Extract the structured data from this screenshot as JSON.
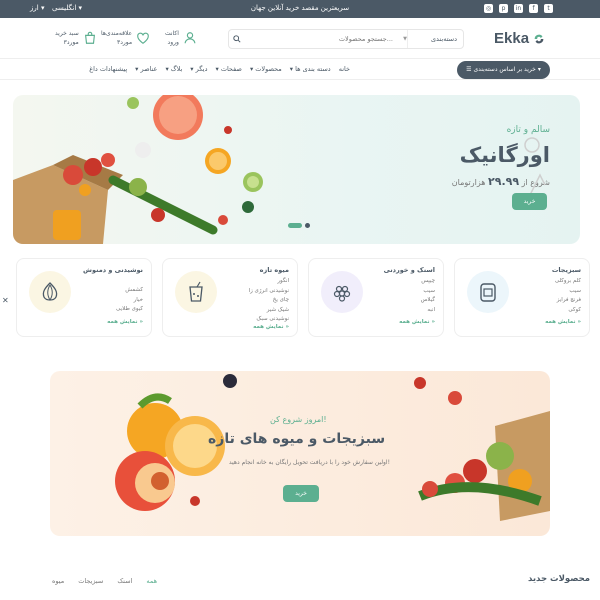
{
  "topbar": {
    "tagline": "سریعترین مقصد خرید آنلاین جهان",
    "language": "انگلیسی ▾",
    "currency": "ارز ▾",
    "socials": [
      "instagram-icon",
      "pinterest-icon",
      "linkedin-icon",
      "facebook-icon",
      "twitter-icon"
    ]
  },
  "header": {
    "logo": "Ekka",
    "search_placeholder": "جستجو محصولات...",
    "search_category": "دسته‌بندی",
    "account_line1": "اکانت",
    "account_line2": "ورود",
    "wishlist_line1": "علاقه‌مندی‌ها",
    "wishlist_line2": "۳مورد",
    "cart_line1": "سبد خرید",
    "cart_line2": "۳مورد"
  },
  "nav": {
    "category_button": "☰ خرید بر اساس دسته‌بندی ▾",
    "links": [
      "خانه",
      "دسته بندی ها ▾",
      "محصولات ▾",
      "صفحات ▾",
      "دیگر ▾",
      "بلاگ ▾",
      "عناصر ▾",
      "پیشنهادات داغ"
    ]
  },
  "hero": {
    "subtitle": "سالم و تازه",
    "title": "اورگانیک",
    "price_prefix": "شروع از",
    "price_value": "۲۹.۹۹",
    "price_suffix": "هزارتومان",
    "button": "خرید",
    "active_slide": 1,
    "slide_count": 2
  },
  "categories": [
    {
      "title": "سبزیجات",
      "items": [
        "کلم بروکلی",
        "سیب",
        "فرنچ فرایز",
        "کوکی"
      ],
      "more": "نمایش همه »",
      "icon": "jar-icon",
      "tint": "#ecf6fb"
    },
    {
      "title": "اسنک و خوردنی",
      "items": [
        "چیپس",
        "سیب",
        "گیلاس",
        "انبه"
      ],
      "more": "نمایش همه »",
      "icon": "grapes-icon",
      "tint": "#f1eefb"
    },
    {
      "title": "میوه تازه",
      "items": [
        "انگور",
        "نوشیدنی انرژی زا",
        "چای یخ",
        "شیک شیر",
        "نوشیدنی سبک"
      ],
      "more": "نمایش همه »",
      "icon": "juice-icon",
      "tint": "#fbf6e3"
    },
    {
      "title": "نوشیدنی و دمنوش",
      "items": [
        "کشمش",
        "خیار",
        "کیوی طلایی"
      ],
      "more": "نمایش همه »",
      "icon": "onion-icon",
      "tint": "#fbf6e3"
    }
  ],
  "promo": {
    "subtitle": "امروز شروع کن!",
    "title": "سبزیجات و میوه های تازه",
    "description": "اولین سفارش خود را با دریافت تحویل رایگان به خانه انجام دهید!",
    "button": "خرید"
  },
  "new_products": {
    "title": "محصولات جدید",
    "tabs": [
      "همه",
      "اسنک",
      "سبزیجات",
      "میوه"
    ],
    "active_tab": 0
  },
  "colors": {
    "primary": "#5caf90",
    "dark": "#4b5966",
    "hero_bg": "#e9f5f3",
    "promo_bg": "#fdf1e6"
  }
}
